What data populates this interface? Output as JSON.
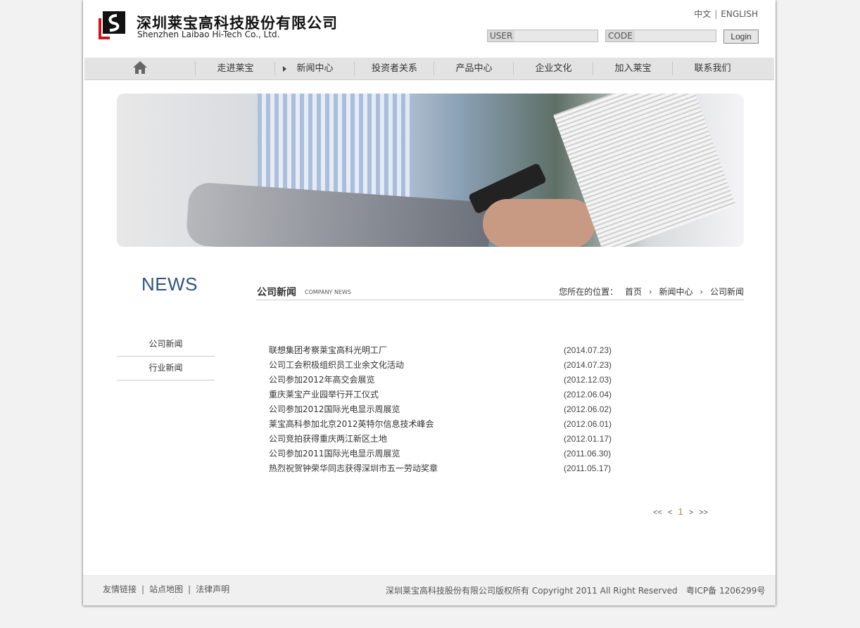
{
  "header": {
    "logo_cn": "深圳莱宝高科技股份有限公司",
    "logo_en": "Shenzhen Laibao Hi-Tech Co., Ltd.",
    "lang_cn": "中文",
    "lang_sep": "|",
    "lang_en": "ENGLISH",
    "user_label": "USER",
    "code_label": "CODE",
    "login_label": "Login"
  },
  "nav": {
    "home_icon": "home-icon",
    "items": [
      {
        "label": "走进莱宝"
      },
      {
        "label": "新闻中心"
      },
      {
        "label": "投资者关系"
      },
      {
        "label": "产品中心"
      },
      {
        "label": "企业文化"
      },
      {
        "label": "加入莱宝"
      },
      {
        "label": "联系我们"
      }
    ]
  },
  "sidebar": {
    "heading": "NEWS",
    "items": [
      {
        "label": "公司新闻"
      },
      {
        "label": "行业新闻"
      }
    ]
  },
  "section": {
    "title": "公司新闻",
    "subtitle": "COMPANY NEWS",
    "breadcrumb_prefix": "您所在的位置：",
    "breadcrumb": [
      "首页",
      "新闻中心",
      "公司新闻"
    ]
  },
  "news": [
    {
      "title": "联想集团考察莱宝高科光明工厂",
      "date": "(2014.07.23)"
    },
    {
      "title": "公司工会积极组织员工业余文化活动",
      "date": "(2014.07.23)"
    },
    {
      "title": "公司参加2012年高交会展览",
      "date": "(2012.12.03)"
    },
    {
      "title": "重庆莱宝产业园举行开工仪式",
      "date": "(2012.06.04)"
    },
    {
      "title": "公司参加2012国际光电显示周展览",
      "date": "(2012.06.02)"
    },
    {
      "title": "莱宝高科参加北京2012英特尔信息技术峰会",
      "date": "(2012.06.01)"
    },
    {
      "title": "公司竞拍获得重庆两江新区土地",
      "date": "(2012.01.17)"
    },
    {
      "title": "公司参加2011国际光电显示周展览",
      "date": "(2011.06.30)"
    },
    {
      "title": "热烈祝贺钟荣华同志获得深圳市五一劳动奖章",
      "date": "(2011.05.17)"
    }
  ],
  "pager": {
    "first": "<<",
    "prev": "<",
    "current": "1",
    "next": ">",
    "last": ">>"
  },
  "footer": {
    "links": [
      "友情链接",
      "站点地图",
      "法律声明"
    ],
    "link_sep": "|",
    "copyright": "深圳莱宝高科技股份有限公司版权所有 Copyright 2011 All Right Reserved",
    "icp": "粤ICP备 1206299号"
  },
  "colors": {
    "accent": "#2e5484",
    "nav_bg": "#e3e3e3",
    "page_bg": "#f2f2f2",
    "pager_current": "#b28a2e"
  }
}
